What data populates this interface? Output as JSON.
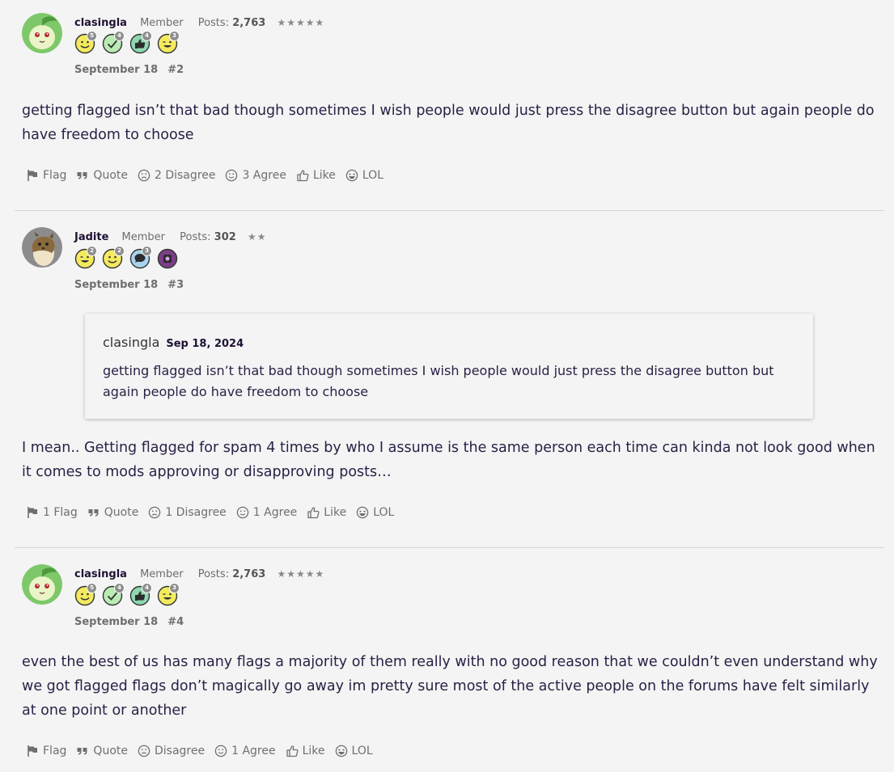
{
  "posts": [
    {
      "username": "clasingla",
      "role": "Member",
      "posts_label": "Posts:",
      "posts_count": "2,763",
      "stars": "★★★★★",
      "badges": [
        {
          "icon": "smiley-badge-icon",
          "count": "5"
        },
        {
          "icon": "checkmark-badge-icon",
          "count": "4"
        },
        {
          "icon": "thumbs-up-badge-icon",
          "count": "4"
        },
        {
          "icon": "wink-badge-icon",
          "count": "3"
        }
      ],
      "date": "September 18",
      "number": "#2",
      "body": "getting flagged isn’t that bad though sometimes I wish people would just press the disagree button but again people do have freedom to choose",
      "actions": {
        "flag": "Flag",
        "quote": "Quote",
        "disagree": "2 Disagree",
        "agree": "3 Agree",
        "like": "Like",
        "lol": "LOL"
      }
    },
    {
      "username": "Jadite",
      "role": "Member",
      "posts_label": "Posts:",
      "posts_count": "302",
      "stars": "★★",
      "badges": [
        {
          "icon": "wink-badge-icon",
          "count": "2"
        },
        {
          "icon": "smiley-badge-icon",
          "count": "2"
        },
        {
          "icon": "speech-bubble-badge-icon",
          "count": "3"
        },
        {
          "icon": "purple-emblem-badge-icon",
          "count": ""
        }
      ],
      "date": "September 18",
      "number": "#3",
      "quote": {
        "author": "clasingla",
        "date": "Sep 18, 2024",
        "text": "getting flagged isn’t that bad though sometimes I wish people would just press the disagree button but again people do have freedom to choose"
      },
      "body": "I mean.. Getting flagged for spam 4 times by who I assume is the same person each time can kinda not look good when it comes to mods approving or disapproving posts…",
      "actions": {
        "flag": "1 Flag",
        "quote": "Quote",
        "disagree": "1 Disagree",
        "agree": "1 Agree",
        "like": "Like",
        "lol": "LOL"
      }
    },
    {
      "username": "clasingla",
      "role": "Member",
      "posts_label": "Posts:",
      "posts_count": "2,763",
      "stars": "★★★★★",
      "badges": [
        {
          "icon": "smiley-badge-icon",
          "count": "5"
        },
        {
          "icon": "checkmark-badge-icon",
          "count": "4"
        },
        {
          "icon": "thumbs-up-badge-icon",
          "count": "4"
        },
        {
          "icon": "wink-badge-icon",
          "count": "3"
        }
      ],
      "date": "September 18",
      "number": "#4",
      "body": "even the best of us has many flags a majority of them really with no good reason that we couldn’t even understand why we got flagged flags don’t magically go away im pretty sure most of the active people on the forums have felt similarly at one point or another",
      "actions": {
        "flag": "Flag",
        "quote": "Quote",
        "disagree": "Disagree",
        "agree": "1 Agree",
        "like": "Like",
        "lol": "LOL"
      }
    }
  ]
}
